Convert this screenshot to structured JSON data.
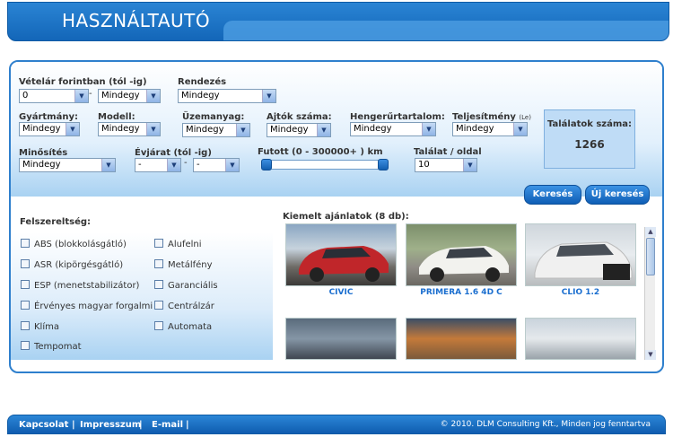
{
  "header": {
    "title": "HASZNÁLTAUTÓ"
  },
  "search": {
    "price_label": "Vételár forintban (tól -ig)",
    "price_from": "0",
    "price_to": "Mindegy",
    "sort_label": "Rendezés",
    "sort_value": "Mindegy",
    "make_label": "Gyártmány:",
    "make_value": "Mindegy",
    "model_label": "Modell:",
    "model_value": "Mindegy",
    "fuel_label": "Üzemanyag:",
    "fuel_value": "Mindegy",
    "doors_label": "Ajtók száma:",
    "doors_value": "Mindegy",
    "engine_label": "Hengerűrtartalom:",
    "engine_value": "Mindegy",
    "power_label": "Teljesítmény",
    "power_unit": "(Le)",
    "power_value": "Mindegy",
    "quality_label": "Minősítés",
    "quality_value": "Mindegy",
    "year_label": "Évjárat (tól -ig)",
    "year_from": "-",
    "year_to": "-",
    "mileage_label": "Futott (0 - 300000+ ) km",
    "mileage_min": 0,
    "mileage_max": 300000,
    "per_page_label": "Találat / oldal",
    "per_page_value": "10",
    "dash": "-",
    "search_button": "Keresés",
    "new_search_button": "Új keresés"
  },
  "results": {
    "label": "Találatok száma:",
    "count": "1266"
  },
  "features": {
    "title": "Felszereltség:",
    "left": [
      "ABS (blokkolásgátló)",
      "ASR (kipörgésgátló)",
      "ESP (menetstabilizátor)",
      "Érvényes magyar forgalmi",
      "Klíma",
      "Tempomat"
    ],
    "right": [
      "Alufelni",
      "Metálfény",
      "Garanciális",
      "Centrálzár",
      "Automata"
    ]
  },
  "featured": {
    "title": "Kiemelt ajánlatok (8 db):",
    "cars": [
      {
        "name": "CIVIC",
        "color": "#c0262a"
      },
      {
        "name": "PRIMERA 1.6 4D C",
        "color": "#f2f2ee"
      },
      {
        "name": "CLIO 1.2",
        "color": "#f0f0f0"
      }
    ]
  },
  "footer": {
    "links": [
      "Kapcsolat",
      "Impresszum",
      "E-mail"
    ],
    "separator": "|",
    "copyright": "© 2010. DLM Consulting Kft., Minden jog fenntartva"
  }
}
